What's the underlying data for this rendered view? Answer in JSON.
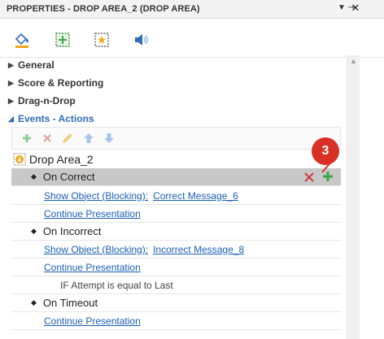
{
  "window": {
    "title": "PROPERTIES - DROP AREA_2 (DROP AREA)",
    "pin_glyph": "▼ ⊸",
    "close_glyph": "✕"
  },
  "toolbar": {
    "icons": [
      "fill-icon",
      "size-position-icon",
      "star-frame-icon",
      "audio-icon"
    ]
  },
  "sections": [
    {
      "label": "General",
      "expanded": false
    },
    {
      "label": "Score & Reporting",
      "expanded": false
    },
    {
      "label": "Drag-n-Drop",
      "expanded": false
    },
    {
      "label": "Events - Actions",
      "expanded": true
    }
  ],
  "actionbar": {
    "icons": [
      "add-icon",
      "delete-icon",
      "edit-icon",
      "move-up-icon",
      "move-down-icon"
    ]
  },
  "tree": {
    "root": "Drop Area_2",
    "events": [
      {
        "name": "On Correct",
        "selected": true
      },
      {
        "name": "On Incorrect",
        "selected": false
      },
      {
        "name": "On Timeout",
        "selected": false
      }
    ],
    "actions": {
      "correct_show": {
        "action": "Show Object (Blocking):",
        "target": "Correct Message_6"
      },
      "correct_continue": "Continue Presentation",
      "incorrect_show": {
        "action": "Show Object (Blocking):",
        "target": "Incorrect Message_8"
      },
      "incorrect_continue": "Continue Presentation",
      "incorrect_condition": "IF Attempt is equal to Last",
      "timeout_continue": "Continue Presentation"
    }
  },
  "callout": {
    "label": "3",
    "color": "#d93025"
  },
  "colors": {
    "link": "#1a5fb4",
    "section_open": "#2d6db5",
    "selected_row": "#c8c8c8",
    "add_green": "#3aa64a",
    "delete_red": "#d03a3a"
  }
}
